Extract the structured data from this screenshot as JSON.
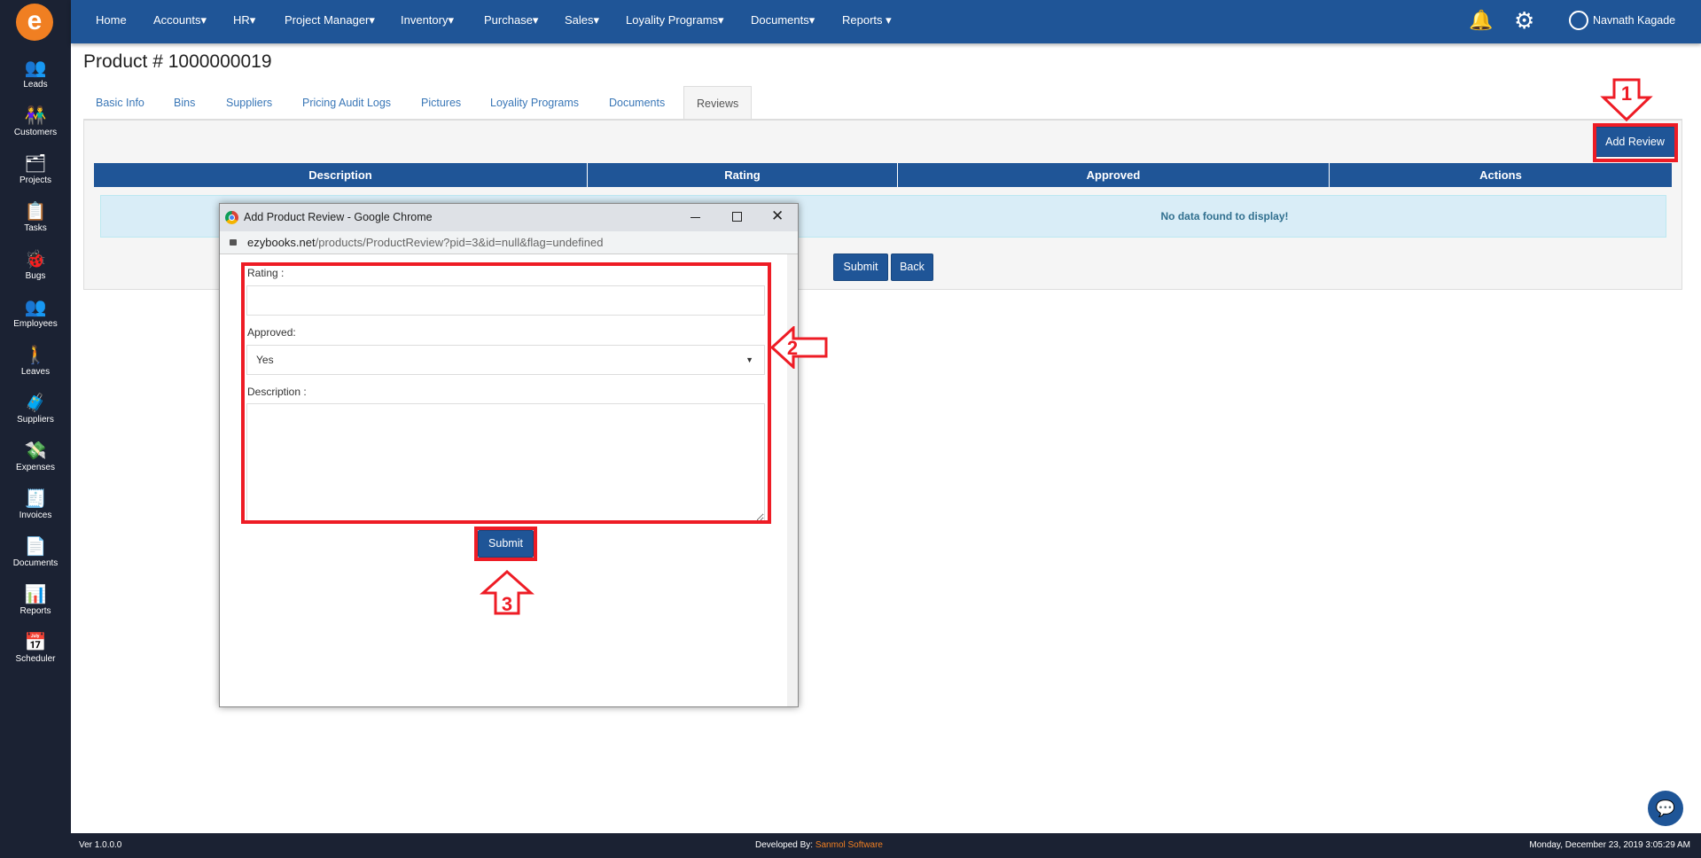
{
  "logo": "e",
  "sidebar": {
    "items": [
      {
        "label": "Leads",
        "icon": "👥"
      },
      {
        "label": "Customers",
        "icon": "👫"
      },
      {
        "label": "Projects",
        "icon": "🗂"
      },
      {
        "label": "Tasks",
        "icon": "📋"
      },
      {
        "label": "Bugs",
        "icon": "🐞"
      },
      {
        "label": "Employees",
        "icon": "👥"
      },
      {
        "label": "Leaves",
        "icon": "🚶"
      },
      {
        "label": "Suppliers",
        "icon": "🧳"
      },
      {
        "label": "Expenses",
        "icon": "💸"
      },
      {
        "label": "Invoices",
        "icon": "🧾"
      },
      {
        "label": "Documents",
        "icon": "📄"
      },
      {
        "label": "Reports",
        "icon": "📊"
      },
      {
        "label": "Scheduler",
        "icon": "📅"
      }
    ]
  },
  "nav": {
    "items": [
      "Home",
      "Accounts▾",
      "HR▾",
      "Project Manager▾",
      "Inventory▾",
      "Purchase▾",
      "Sales▾",
      "Loyality Programs▾",
      "Documents▾",
      "Reports ▾"
    ],
    "user": "Navnath Kagade",
    "bell": "🔔",
    "gear": "⚙"
  },
  "page": {
    "title": "Product # 1000000019",
    "tabs": [
      "Basic Info",
      "Bins",
      "Suppliers",
      "Pricing Audit Logs",
      "Pictures",
      "Loyality Programs",
      "Documents",
      "Reviews"
    ],
    "active_tab": "Reviews",
    "add_review": "Add Review",
    "table": {
      "headers": [
        "Description",
        "Rating",
        "Approved",
        "Actions"
      ],
      "empty": "No data found to display!"
    },
    "submit": "Submit",
    "back": "Back"
  },
  "popup": {
    "title": "Add Product Review - Google Chrome",
    "url_host": "ezybooks.net",
    "url_path": "/products/ProductReview?pid=3&id=null&flag=undefined",
    "rating_label": "Rating :",
    "rating_value": "",
    "approved_label": "Approved:",
    "approved_value": "Yes",
    "description_label": "Description :",
    "description_value": "",
    "submit": "Submit"
  },
  "annotations": [
    "1",
    "2",
    "3"
  ],
  "annotation_color": "#ee1c25",
  "footer": {
    "version": "Ver 1.0.0.0",
    "developed_by": "Developed By:",
    "company": "Sanmol Software",
    "datetime": "Monday, December 23, 2019 3:05:29 AM"
  },
  "colors": {
    "primary": "#1f5597",
    "sidebar": "#1b2233",
    "accent": "#f07f22"
  }
}
